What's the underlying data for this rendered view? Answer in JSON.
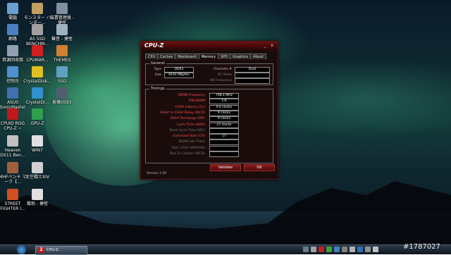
{
  "desktop_icons": [
    {
      "label": "電腦",
      "color": "#6aa0d0"
    },
    {
      "label": "モンスター ハンター...",
      "color": "#c0a060"
    },
    {
      "label": "裝置管理員 - 捷徑",
      "color": "#8090a0"
    },
    {
      "label": "網路",
      "color": "#4a80c0"
    },
    {
      "label": "AS SSD BENCHM...",
      "color": "#a0a0a0"
    },
    {
      "label": "聲音 - 捷徑",
      "color": "#a0b0c0"
    },
    {
      "label": "資源回收筒",
      "color": "#90a0b0"
    },
    {
      "label": "CPUMAR...",
      "color": "#d02020"
    },
    {
      "label": "THEMES",
      "color": "#d08030"
    },
    {
      "label": "控制台",
      "color": "#5090d0"
    },
    {
      "label": "CrystalDisk...",
      "color": "#e0c020"
    },
    {
      "label": "SSD",
      "color": "#60a0c0"
    },
    {
      "label": "ASUS SonicMaster",
      "color": "#4070b0"
    },
    {
      "label": "CrystalDi...",
      "color": "#3090d0"
    },
    {
      "label": "影像0583",
      "color": "#506070"
    },
    {
      "label": "CPUID ROG CPU-Z ~",
      "color": "#c01818"
    },
    {
      "label": "GPU-Z",
      "color": "#30a050"
    },
    {
      "label": "Heaven DX11 Ben...",
      "color": "#c0c0c0"
    },
    {
      "label": "WIN7",
      "color": "#e0e0e0"
    },
    {
      "label": "MHFベンチ マーク【...",
      "color": "#a06040"
    },
    {
      "label": "太空戰士XIV",
      "color": "#d0d0d0"
    },
    {
      "label": "STREET FIGHTER I...",
      "color": "#d05020"
    },
    {
      "label": "幫助 - 捷徑",
      "color": "#e0e0e0"
    }
  ],
  "window": {
    "title": "CPU-Z",
    "minimize_glyph": "_",
    "close_glyph": "x",
    "tabs": [
      "CPU",
      "Caches",
      "Mainboard",
      "Memory",
      "SPD",
      "Graphics",
      "About"
    ],
    "active_tab": "Memory",
    "general": {
      "group_label": "General",
      "type_label": "Type",
      "type_value": "DDR3",
      "size_label": "Size",
      "size_value": "8192 MBytes",
      "channels_label": "Channels #",
      "channels_value": "Dual",
      "dc_mode_label": "DC Mode",
      "dc_mode_value": "",
      "nb_freq_label": "NB Frequency",
      "nb_freq_value": ""
    },
    "timings": {
      "group_label": "Timings",
      "rows": [
        {
          "label": "DRAM Frequency",
          "value": "798.4 MHz",
          "style": "red"
        },
        {
          "label": "FSB:DRAM",
          "value": "1:6",
          "style": "red"
        },
        {
          "label": "CAS# Latency (CL)",
          "value": "9.0 clocks",
          "style": "red"
        },
        {
          "label": "RAS# to CAS# Delay (tRCD)",
          "value": "9 clocks",
          "style": "red"
        },
        {
          "label": "RAS# Precharge (tRP)",
          "value": "9 clocks",
          "style": "red"
        },
        {
          "label": "Cycle Time (tRAS)",
          "value": "27 clocks",
          "style": "red"
        },
        {
          "label": "Bank Cycle Time (tRC)",
          "value": "",
          "style": "grey"
        },
        {
          "label": "Command Rate (CR)",
          "value": "1T",
          "style": "red"
        },
        {
          "label": "DRAM Idle Timer",
          "value": "",
          "style": "grey"
        },
        {
          "label": "Total CAS# (tRDRAM)",
          "value": "",
          "style": "grey"
        },
        {
          "label": "Row To Column (tRCD)",
          "value": "",
          "style": "grey"
        }
      ]
    },
    "version": "Version 1.59",
    "validate_label": "Validate",
    "ok_label": "OK"
  },
  "taskbar": {
    "task_button_label": "CPU-Z",
    "task_icon_glyph": "Z"
  },
  "watermark": "#1787027"
}
